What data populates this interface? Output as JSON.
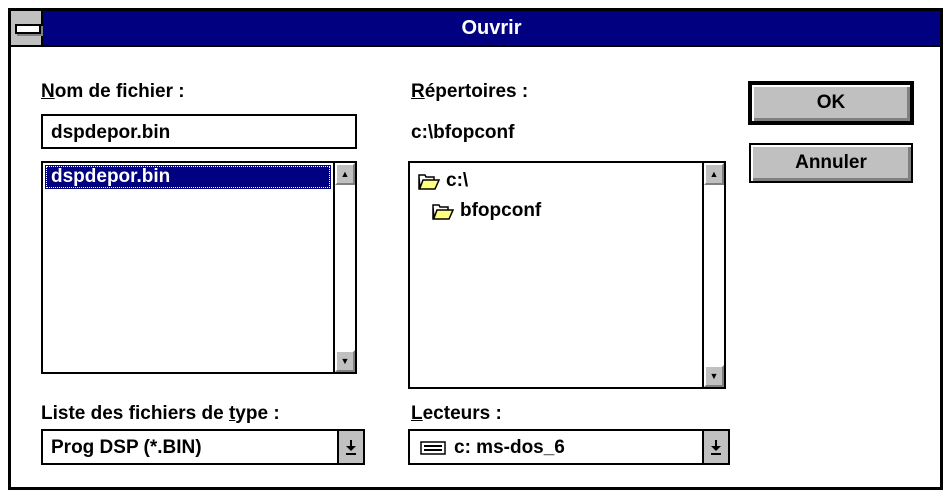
{
  "dialog": {
    "title": "Ouvrir"
  },
  "filename": {
    "label_accel": "N",
    "label_rest": "om de fichier :",
    "value": "dspdepor.bin",
    "files": [
      "dspdepor.bin"
    ]
  },
  "directories": {
    "label_accel": "R",
    "label_rest": "épertoires :",
    "current_path": "c:\\bfopconf",
    "items": [
      {
        "name": "c:\\",
        "icon": "open-folder-icon"
      },
      {
        "name": "bfopconf",
        "icon": "open-folder-icon"
      }
    ]
  },
  "filetype": {
    "label_pre": "Liste des fichiers de ",
    "label_accel": "t",
    "label_post": "ype :",
    "selected": "Prog DSP (*.BIN)"
  },
  "drives": {
    "label_accel": "L",
    "label_rest": "ecteurs :",
    "selected": "c: ms-dos_6",
    "icon": "hard-drive-icon"
  },
  "buttons": {
    "ok": "OK",
    "cancel": "Annuler"
  },
  "colors": {
    "titlebar": "#000080",
    "selection": "#000080",
    "button_face": "#c0c0c0",
    "folder": "#ffff80"
  }
}
